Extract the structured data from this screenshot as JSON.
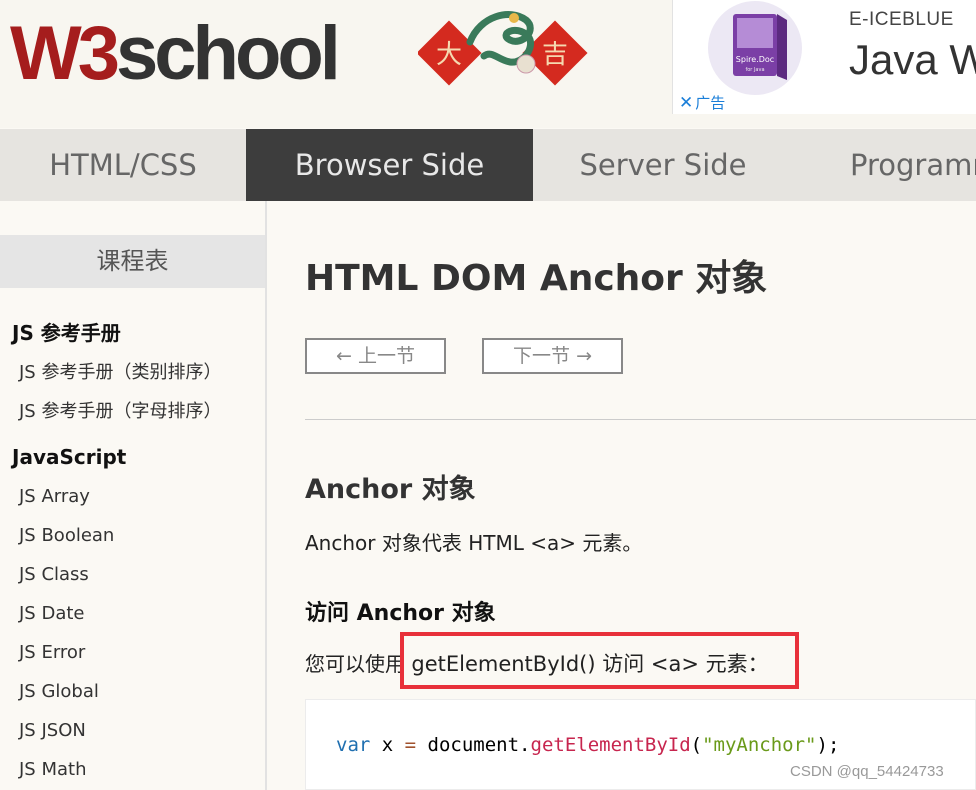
{
  "header": {
    "logo": {
      "w3": "W3",
      "school": "school"
    },
    "festival": {
      "char_left": "大",
      "char_right": "吉"
    },
    "ad": {
      "brand": "E-ICEBLUE",
      "title": "Java W",
      "close_icon": "close-icon",
      "close_label": "广告",
      "product_label": "Spire.Doc",
      "product_sublabel": "for Java"
    }
  },
  "nav": {
    "tabs": [
      {
        "label": "HTML/CSS",
        "active": false
      },
      {
        "label": "Browser Side",
        "active": true
      },
      {
        "label": "Server Side",
        "active": false
      },
      {
        "label": "Programm",
        "active": false
      }
    ]
  },
  "sidebar": {
    "title": "课程表",
    "sections": [
      {
        "heading": "JS 参考手册",
        "items": [
          "JS 参考手册（类别排序）",
          "JS 参考手册（字母排序）"
        ]
      },
      {
        "heading": "JavaScript",
        "items": [
          "JS Array",
          "JS Boolean",
          "JS Class",
          "JS Date",
          "JS Error",
          "JS Global",
          "JS JSON",
          "JS Math"
        ]
      }
    ]
  },
  "main": {
    "title": "HTML DOM Anchor 对象",
    "prev_label": "上一节",
    "next_label": "下一节",
    "section_title": "Anchor 对象",
    "section_desc": "Anchor 对象代表 HTML <a> 元素。",
    "access_title": "访问 Anchor 对象",
    "access_prefix": "您可以使用",
    "access_mid": "getElementById() 访问 <a> 元素：",
    "code": {
      "kw": "var",
      "var": " x ",
      "op": "=",
      "obj": " document.",
      "fn": "getElementById",
      "open": "(",
      "str": "\"myAnchor\"",
      "close": ");"
    }
  },
  "watermark": "CSDN @qq_54424733",
  "colors": {
    "accent_red": "#a51d1d",
    "nav_active_bg": "#3d3d3d",
    "highlight_border": "#e8303a",
    "ad_close": "#1a7ed8"
  }
}
